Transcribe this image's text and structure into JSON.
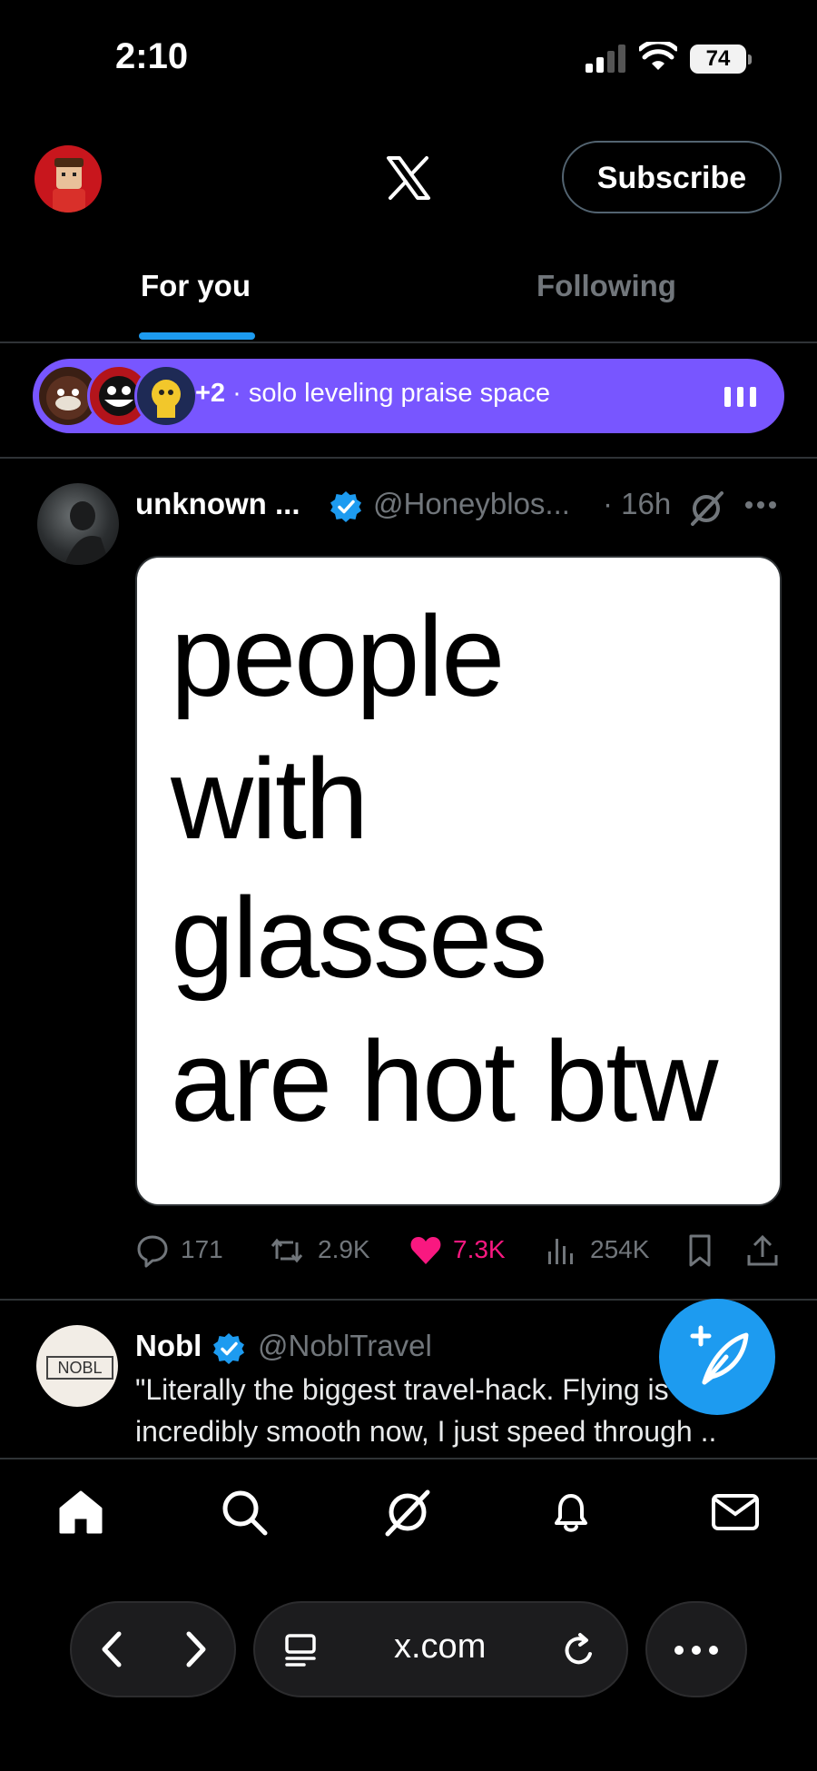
{
  "status_bar": {
    "time": "2:10",
    "battery": "74"
  },
  "header": {
    "subscribe_label": "Subscribe"
  },
  "tabs": [
    {
      "label": "For you"
    },
    {
      "label": "Following"
    }
  ],
  "space": {
    "extra_count": "+2",
    "separator": "·",
    "title": "solo leveling praise space"
  },
  "tweets": [
    {
      "name": "unknown ...",
      "handle": "@Honeyblos...",
      "time": "· 16h",
      "media_lines": [
        "people",
        "with",
        "glasses",
        "are hot btw"
      ],
      "replies": "171",
      "reposts": "2.9K",
      "likes": "7.3K",
      "views": "254K"
    },
    {
      "name": "Nobl",
      "handle": "@NoblTravel",
      "avatar_text": "NOBL",
      "body_line1": "\"Literally the biggest travel-hack. Flying is",
      "body_line2": "incredibly smooth now, I just speed through .."
    }
  ],
  "browser": {
    "url": "x.com"
  },
  "colors": {
    "accent": "#1d9bf0",
    "space": "#7856ff",
    "like": "#f91880",
    "muted": "#71767b"
  }
}
